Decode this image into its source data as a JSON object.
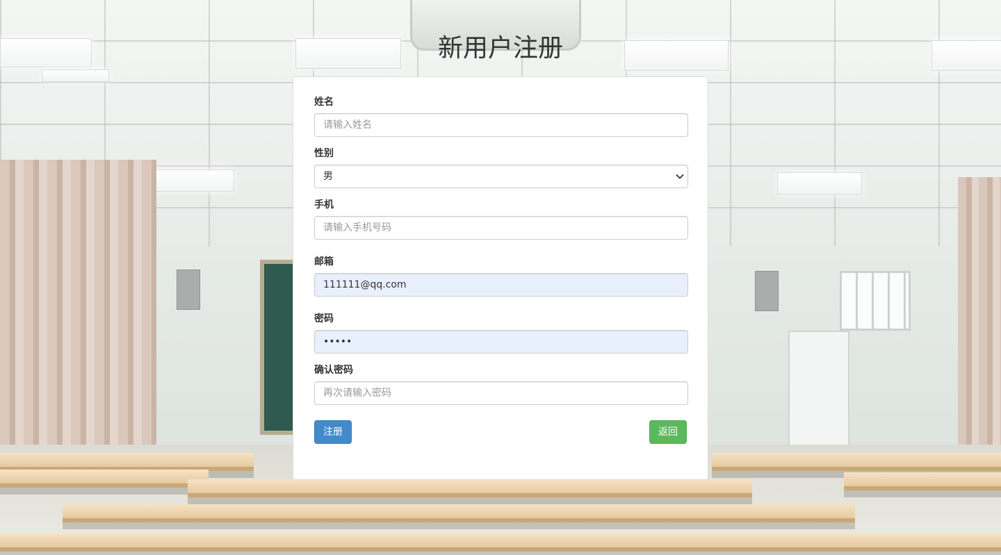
{
  "page": {
    "title": "新用户注册"
  },
  "form": {
    "name": {
      "label": "姓名",
      "placeholder": "请输入姓名",
      "value": ""
    },
    "gender": {
      "label": "性别",
      "selected": "男"
    },
    "phone": {
      "label": "手机",
      "placeholder": "请输入手机号码",
      "value": ""
    },
    "email": {
      "label": "邮箱",
      "value": "111111@qq.com"
    },
    "password": {
      "label": "密码",
      "value": "•••••"
    },
    "confirm_password": {
      "label": "确认密码",
      "placeholder": "再次请输入密码",
      "value": ""
    },
    "buttons": {
      "register_label": "注册",
      "back_label": "返回"
    }
  },
  "colors": {
    "primary": "#428bca",
    "success": "#5cb85c",
    "autofill": "#e8f0fe"
  },
  "icons": {
    "select_arrow": "chevron-down-icon"
  }
}
